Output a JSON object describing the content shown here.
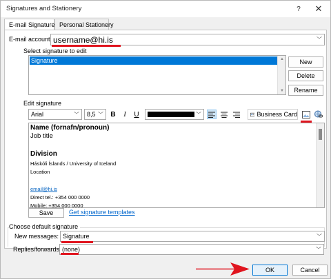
{
  "window": {
    "title": "Signatures and Stationery",
    "help": "?",
    "close": "✕"
  },
  "tabs": [
    {
      "label": "E-mail Signature"
    },
    {
      "label": "Personal Stationery"
    }
  ],
  "email_account": {
    "label": "E-mail account:",
    "value": "username@hi.is"
  },
  "select_signature": {
    "label": "Select signature to edit",
    "items": [
      "Signature"
    ],
    "new_label": "New",
    "delete_label": "Delete",
    "rename_label": "Rename"
  },
  "edit_signature": {
    "label": "Edit signature",
    "font": "Arial",
    "size": "8,5",
    "bold": "B",
    "italic": "I",
    "underline": "U",
    "business_card_label": "Business Card",
    "content": {
      "name": "Name (fornafn/pronoun)",
      "job_title": "Job title",
      "division": "Division",
      "organization": "Háskóli Íslands / University of Iceland",
      "location": "Location",
      "email": "email@hi.is",
      "direct_tel": "Direct tel.: +354 000 0000",
      "mobile": "Mobile: +354 000 0000"
    },
    "save_label": "Save",
    "templates_link": "Get signature templates"
  },
  "default_signature": {
    "label": "Choose default signature",
    "new_messages_label": "New messages:",
    "new_messages_value": "Signature",
    "replies_label": "Replies/forwards:",
    "replies_value": "(none)"
  },
  "footer": {
    "ok_label": "OK",
    "cancel_label": "Cancel"
  },
  "colors": {
    "accent": "#0078d7",
    "annotation": "#e0141e"
  }
}
